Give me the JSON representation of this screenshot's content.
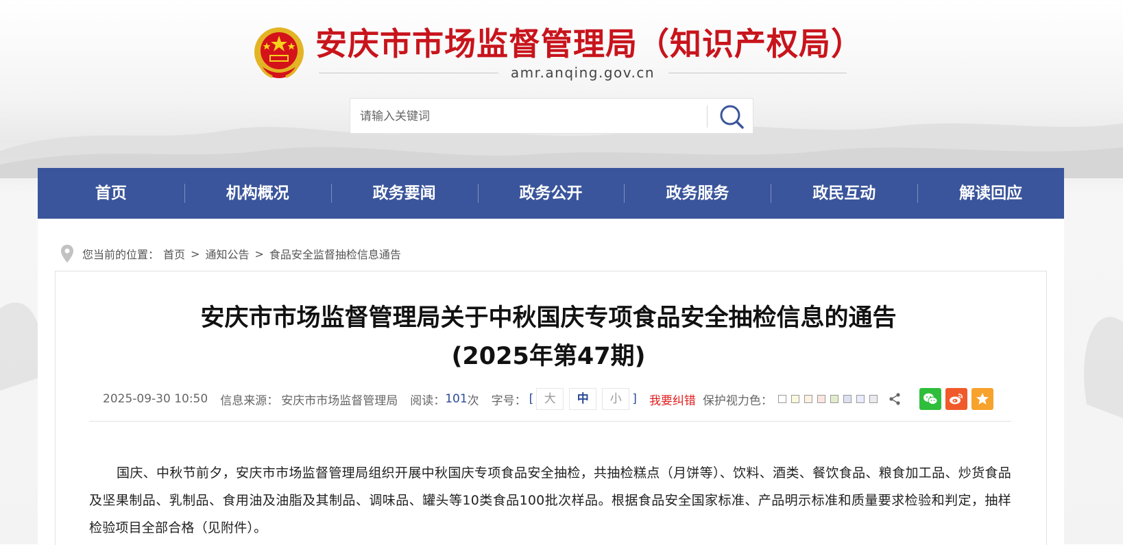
{
  "header": {
    "site_title": "安庆市市场监督管理局（知识产权局）",
    "domain": "amr.anqing.gov.cn",
    "emblem_icon": "national-emblem-icon"
  },
  "search": {
    "placeholder": "请输入关键词",
    "icon": "search-icon"
  },
  "nav": {
    "items": [
      "首页",
      "机构概况",
      "政务要闻",
      "政务公开",
      "政务服务",
      "政民互动",
      "解读回应"
    ]
  },
  "breadcrumb": {
    "prefix": "您当前的位置：",
    "items": [
      "首页",
      "通知公告",
      "食品安全监督抽检信息通告"
    ],
    "separator": ">"
  },
  "article": {
    "title_line1": "安庆市市场监督管理局关于中秋国庆专项食品安全抽检信息的通告",
    "title_line2": "(2025年第47期)",
    "date": "2025-09-30 10:50",
    "source_label": "信息来源：",
    "source": "安庆市市场监督管理局",
    "read_label": "阅读：",
    "read_count": "101",
    "read_unit": "次",
    "font_label": "字号：",
    "font_sizes": [
      "大",
      "中",
      "小"
    ],
    "font_selected": "中",
    "bracket_open": "[",
    "bracket_close": "]",
    "report_link": "我要纠错",
    "eye_care_label": "保护视力色：",
    "eye_care_colors": [
      "#ffffff",
      "#faf9de",
      "#fff2e2",
      "#fde6e0",
      "#e3edcd",
      "#dce2f1",
      "#e9ebfe",
      "#eaeaef"
    ],
    "paragraph": "国庆、中秋节前夕，安庆市市场监督管理局组织开展中秋国庆专项食品安全抽检，共抽检糕点（月饼等）、饮料、酒类、餐饮食品、粮食加工品、炒货食品及坚果制品、乳制品、食用油及油脂及其制品、调味品、罐头等10类食品100批次样品。根据食品安全国家标准、产品明示标准和质量要求检验和判定，抽样检验项目全部合格（见附件）。"
  },
  "colors": {
    "nav_bg": "#3a559b",
    "title_red": "#c8141c",
    "accent_blue": "#2a4a96",
    "report_red": "#e01e1e",
    "wechat": "#2fbe3b",
    "weibo": "#f05a2a",
    "favorite": "#f7a22c"
  }
}
